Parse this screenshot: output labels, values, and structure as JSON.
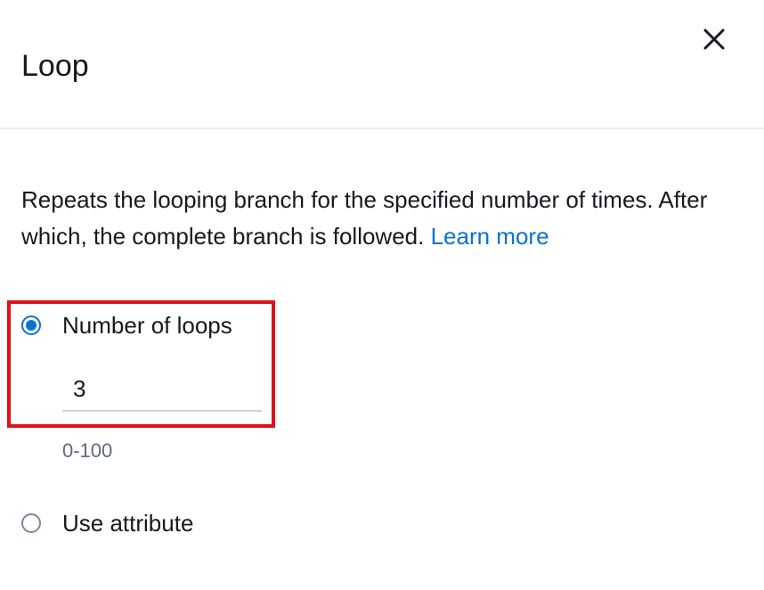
{
  "modal": {
    "title": "Loop",
    "close_icon": "close-icon"
  },
  "description": {
    "text": "Repeats the looping branch for the specified number of times. After which, the complete branch is followed.",
    "link_label": "Learn more"
  },
  "options": [
    {
      "label": "Number of loops",
      "checked": true,
      "input_value": "3",
      "hint": "0-100"
    },
    {
      "label": "Use attribute",
      "checked": false
    }
  ],
  "colors": {
    "accent": "#0972d3",
    "highlight": "#e0101a",
    "text": "#16191f",
    "muted": "#5f6b7a"
  }
}
